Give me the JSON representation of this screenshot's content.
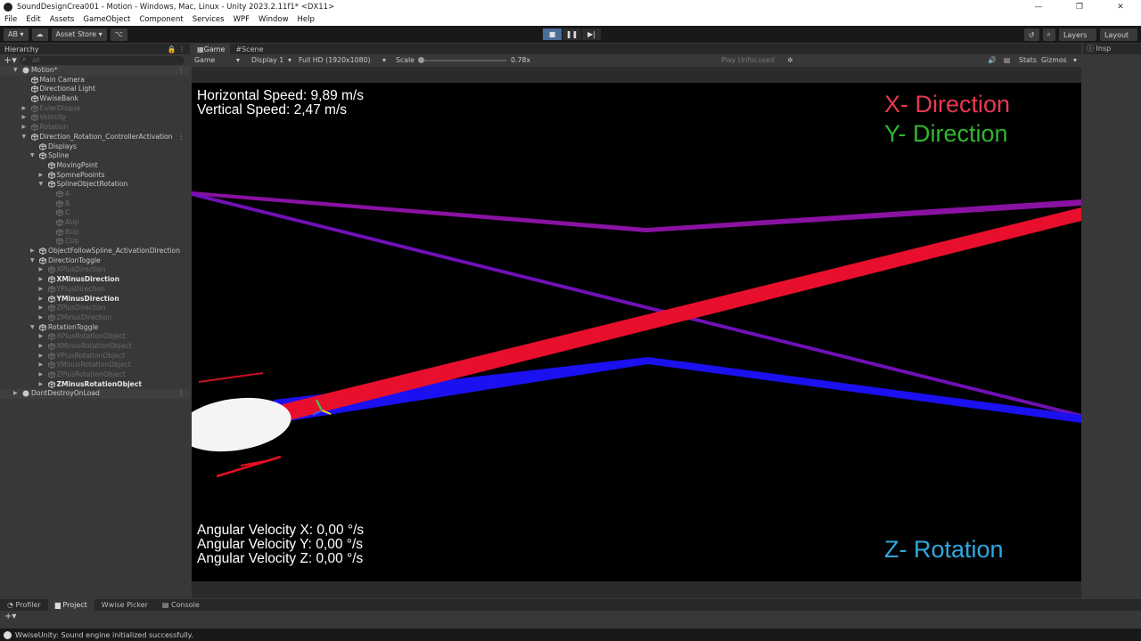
{
  "window": {
    "title": "SoundDesignCrea001 - Motion - Windows, Mac, Linux - Unity 2023.2.11f1* <DX11>",
    "controls": [
      "—",
      "❐",
      "✕"
    ]
  },
  "menu": [
    "File",
    "Edit",
    "Assets",
    "GameObject",
    "Component",
    "Services",
    "WPF",
    "Window",
    "Help"
  ],
  "toolbar": {
    "account": "AB ▾",
    "asset_store": "Asset Store ▾",
    "layers": "Layers",
    "layout": "Layout"
  },
  "hierarchy": {
    "tab_label": "Hierarchy",
    "search_placeholder": "All",
    "items": [
      {
        "label": "Motion*",
        "depth": 0,
        "expanded": true,
        "style": "scene"
      },
      {
        "label": "Main Camera",
        "depth": 1,
        "style": "normal"
      },
      {
        "label": "Directional Light",
        "depth": 1,
        "style": "normal"
      },
      {
        "label": "WwiseBank",
        "depth": 1,
        "style": "normal"
      },
      {
        "label": "EulerDisque",
        "depth": 1,
        "collapsed": true,
        "style": "dim"
      },
      {
        "label": "Velocity",
        "depth": 1,
        "collapsed": true,
        "style": "dim"
      },
      {
        "label": "Rotation",
        "depth": 1,
        "collapsed": true,
        "style": "dim"
      },
      {
        "label": "Direction_Rotation_ControllerActivation",
        "depth": 1,
        "expanded": true,
        "style": "normal"
      },
      {
        "label": "Displays",
        "depth": 2,
        "style": "normal"
      },
      {
        "label": "Spline",
        "depth": 2,
        "expanded": true,
        "style": "normal"
      },
      {
        "label": "MovingPoint",
        "depth": 3,
        "style": "normal"
      },
      {
        "label": "SpmnePooints",
        "depth": 3,
        "collapsed": true,
        "style": "normal"
      },
      {
        "label": "SplineObjectRotation",
        "depth": 3,
        "expanded": true,
        "style": "normal"
      },
      {
        "label": "A",
        "depth": 4,
        "style": "dim"
      },
      {
        "label": "B",
        "depth": 4,
        "style": "dim"
      },
      {
        "label": "C",
        "depth": 4,
        "style": "dim"
      },
      {
        "label": "AUp",
        "depth": 4,
        "style": "dim"
      },
      {
        "label": "BUp",
        "depth": 4,
        "style": "dim"
      },
      {
        "label": "CUp",
        "depth": 4,
        "style": "dim"
      },
      {
        "label": "ObjectFollowSpline_ActivationDirection",
        "depth": 2,
        "collapsed": true,
        "style": "normal"
      },
      {
        "label": "DirectionToggle",
        "depth": 2,
        "expanded": true,
        "style": "normal"
      },
      {
        "label": "XPlusDirection",
        "depth": 3,
        "collapsed": true,
        "style": "dim"
      },
      {
        "label": "XMinusDirection",
        "depth": 3,
        "collapsed": true,
        "style": "bright"
      },
      {
        "label": "YPlusDirection",
        "depth": 3,
        "collapsed": true,
        "style": "dim"
      },
      {
        "label": "YMinusDirection",
        "depth": 3,
        "collapsed": true,
        "style": "bright"
      },
      {
        "label": "ZPlusDirection",
        "depth": 3,
        "collapsed": true,
        "style": "dim"
      },
      {
        "label": "ZMinusDirection",
        "depth": 3,
        "collapsed": true,
        "style": "dim"
      },
      {
        "label": "RotationToggle",
        "depth": 2,
        "expanded": true,
        "style": "normal"
      },
      {
        "label": "XPlusRotationObject",
        "depth": 3,
        "collapsed": true,
        "style": "dim"
      },
      {
        "label": "XMinusRotationObject",
        "depth": 3,
        "collapsed": true,
        "style": "dim"
      },
      {
        "label": "YPlusRotationObject",
        "depth": 3,
        "collapsed": true,
        "style": "dim"
      },
      {
        "label": "YMinusRotationObject",
        "depth": 3,
        "collapsed": true,
        "style": "dim"
      },
      {
        "label": "ZPlusRotationObject",
        "depth": 3,
        "collapsed": true,
        "style": "dim"
      },
      {
        "label": "ZMinusRotationObject",
        "depth": 3,
        "collapsed": true,
        "style": "bright"
      },
      {
        "label": "DontDestroyOnLoad",
        "depth": 0,
        "collapsed": true,
        "style": "scene"
      }
    ]
  },
  "game_view": {
    "tabs": [
      "Game",
      "Scene"
    ],
    "mode": "Game",
    "display": "Display 1",
    "resolution": "Full HD (1920x1080)",
    "scale_label": "Scale",
    "scale_value": "0.78x",
    "play_focus": "Play Unfocused",
    "stats": "Stats",
    "gizmos": "Gizmos",
    "hud": {
      "horizontal_speed": "Horizontal Speed: 9,89 m/s",
      "vertical_speed": "Vertical Speed: 2,47 m/s",
      "angular_x": "Angular Velocity X: 0,00 °/s",
      "angular_y": "Angular Velocity Y: 0,00 °/s",
      "angular_z": "Angular Velocity Z: 0,00 °/s",
      "x_direction": "X- Direction",
      "y_direction": "Y- Direction",
      "z_rotation": "Z- Rotation"
    },
    "colors": {
      "x_direction": "#e8384f",
      "y_direction": "#2fb62f",
      "z_rotation": "#2fa8e0",
      "red_beam": "#e8102a",
      "blue_beam": "#1010f0",
      "purple_line": "#8a10a0"
    }
  },
  "inspector": {
    "tab_label": "Insp"
  },
  "bottom": {
    "tabs": [
      "Profiler",
      "Project",
      "Wwise Picker",
      "Console"
    ],
    "active": "Project"
  },
  "status": {
    "message": "WwiseUnity: Sound engine initialized successfully."
  }
}
